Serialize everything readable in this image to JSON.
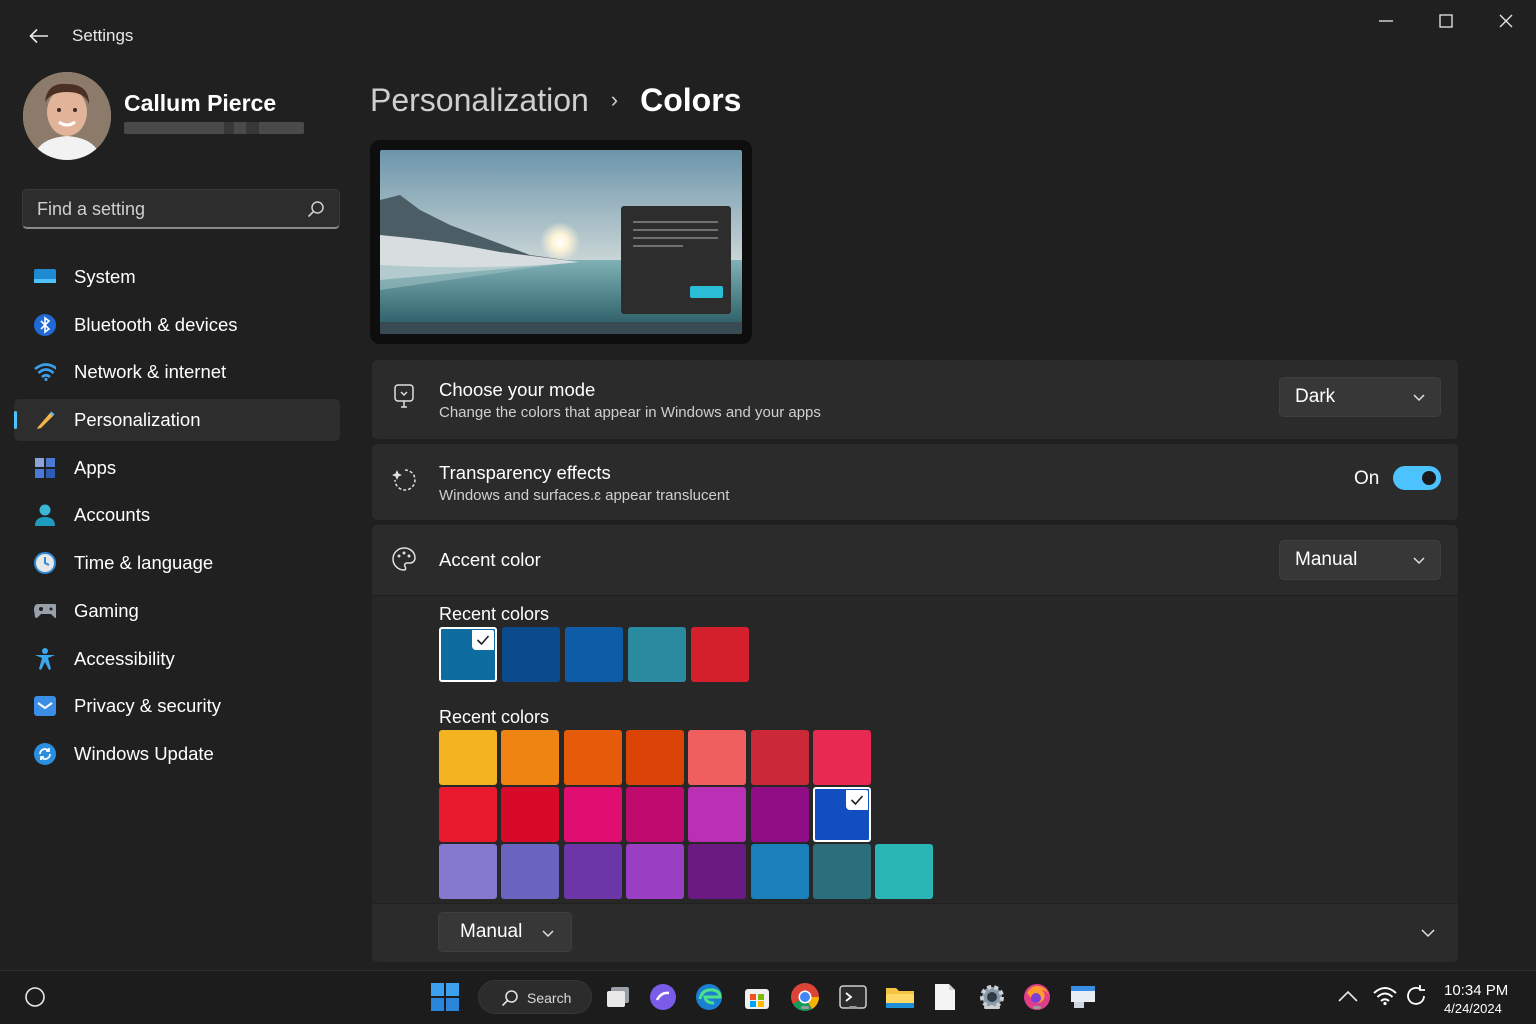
{
  "window": {
    "title": "Settings"
  },
  "user": {
    "name": "Callum Pierce"
  },
  "search": {
    "placeholder": "Find a setting"
  },
  "sidebar": {
    "items": [
      {
        "label": "System",
        "icon": "system-icon"
      },
      {
        "label": "Bluetooth & devices",
        "icon": "bluetooth-icon"
      },
      {
        "label": "Network & internet",
        "icon": "wifi-icon"
      },
      {
        "label": "Personalization",
        "icon": "pencil-icon",
        "active": true
      },
      {
        "label": "Apps",
        "icon": "apps-icon"
      },
      {
        "label": "Accounts",
        "icon": "person-icon"
      },
      {
        "label": "Time & language",
        "icon": "clock-globe-icon"
      },
      {
        "label": "Gaming",
        "icon": "gamepad-icon"
      },
      {
        "label": "Accessibility",
        "icon": "accessibility-icon"
      },
      {
        "label": "Privacy & security",
        "icon": "shield-icon"
      },
      {
        "label": "Windows Update",
        "icon": "update-icon"
      }
    ]
  },
  "breadcrumb": {
    "parent": "Personalization",
    "separator": "›",
    "current": "Colors"
  },
  "mode_card": {
    "title": "Choose your mode",
    "subtitle": "Change the colors that appear in Windows and your apps",
    "value": "Dark"
  },
  "transparency_card": {
    "title": "Transparency effects",
    "subtitle": "Windows and surfaces.ɛ appear translucent",
    "state_label": "On",
    "enabled": true
  },
  "accent_card": {
    "title": "Accent color",
    "value": "Manual"
  },
  "recent_colors": {
    "label": "Recent colors",
    "swatches": [
      "#0f6ca0",
      "#0b4a8c",
      "#0e5ba8",
      "#2a8aa0",
      "#d41f2d"
    ],
    "selected_index": 0
  },
  "windows_colors": {
    "label": "Recent colors",
    "rows": [
      [
        "#f3b320",
        "#f08412",
        "#e55b0a",
        "#dc4307",
        "#ef5f5f",
        "#cc2938",
        "#e82951"
      ],
      [
        "#e8192c",
        "#d80a2a",
        "#e00e70",
        "#c00b6e",
        "#b930b4",
        "#8f0d85",
        "#134ec0"
      ],
      [
        "#8579cf",
        "#6a64c1",
        "#6c36a8",
        "#9a3ec4",
        "#6b1a82",
        "#1a80ba",
        "#2d6e7d",
        "#2bb6b6"
      ]
    ],
    "selected": [
      1,
      6
    ]
  },
  "bottom_card": {
    "value": "Manual"
  },
  "taskbar": {
    "search_label": "Search",
    "time": "10:34 PM",
    "date": "4/24/2024"
  },
  "colors": {
    "accent": "#4cc2ff",
    "background": "#202020",
    "card": "#2b2b2b"
  }
}
